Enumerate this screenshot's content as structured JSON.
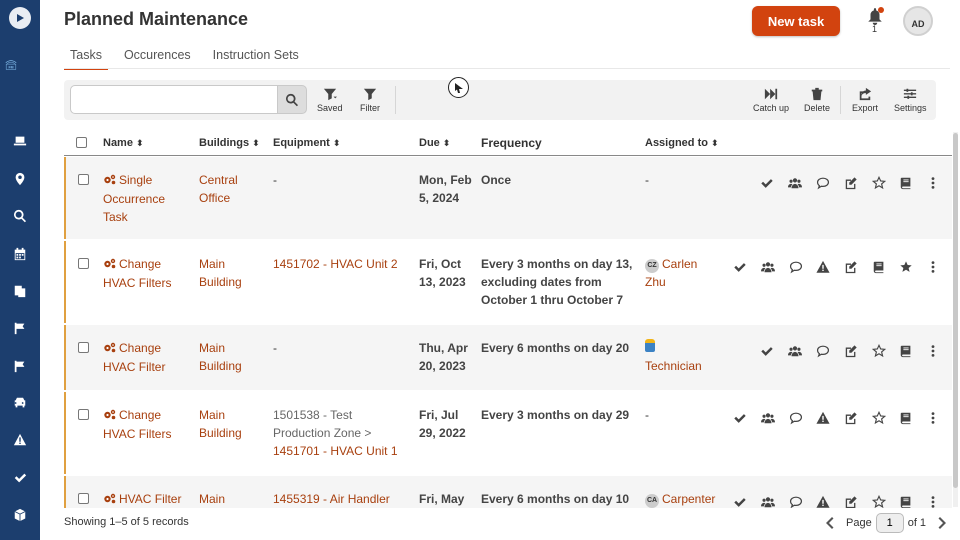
{
  "app": {
    "title": "Planned Maintenance",
    "new_task_label": "New task",
    "notifications_count": "1",
    "user_initials": "AD"
  },
  "tabs": [
    {
      "label": "Tasks",
      "active": true
    },
    {
      "label": "Occurences",
      "active": false
    },
    {
      "label": "Instruction Sets",
      "active": false
    }
  ],
  "toolbar": {
    "search_value": "",
    "search_placeholder": "",
    "saved_label": "Saved",
    "filter_label": "Filter",
    "catch_up_label": "Catch up",
    "delete_label": "Delete",
    "export_label": "Export",
    "settings_label": "Settings"
  },
  "table": {
    "columns": {
      "name": "Name",
      "buildings": "Buildings",
      "equipment": "Equipment",
      "due": "Due",
      "frequency": "Frequency",
      "assigned": "Assigned to"
    },
    "rows": [
      {
        "name": [
          "Single",
          "Occurrence",
          "Task"
        ],
        "building": [
          "Central",
          "Office"
        ],
        "equipment_plain": [
          "-"
        ],
        "equipment_link": [],
        "due": [
          "Mon, Feb",
          "5, 2024"
        ],
        "frequency": [
          "Once"
        ],
        "assigned": [
          "-"
        ],
        "assigned_badge": "",
        "assigned_link": false
      },
      {
        "name": [
          "Change",
          "HVAC Filters"
        ],
        "building": [
          "Main",
          "Building"
        ],
        "equipment_plain": [],
        "equipment_link": [
          "1451702 - HVAC Unit 2"
        ],
        "due": [
          "Fri, Oct",
          "13, 2023"
        ],
        "frequency": [
          "Every 3 months on day 13,",
          "excluding dates from",
          "October 1 thru October 7"
        ],
        "assigned": [
          "Carlen",
          "Zhu"
        ],
        "assigned_badge": "CZ",
        "assigned_link": true
      },
      {
        "name": [
          "Change",
          "HVAC Filter"
        ],
        "building": [
          "Main",
          "Building"
        ],
        "equipment_plain": [
          "-"
        ],
        "equipment_link": [],
        "due": [
          "Thu, Apr",
          "20, 2023"
        ],
        "frequency": [
          "Every 6 months on day 20"
        ],
        "assigned": [
          "Technician"
        ],
        "assigned_badge": "",
        "assigned_link": true
      },
      {
        "name": [
          "Change",
          "HVAC Filters"
        ],
        "building": [
          "Main",
          "Building"
        ],
        "equipment_plain": [
          "1501538 - Test",
          "Production Zone >"
        ],
        "equipment_link": [
          "1451701 - HVAC Unit 1"
        ],
        "due": [
          "Fri, Jul",
          "29, 2022"
        ],
        "frequency": [
          "Every 3 months on day 29"
        ],
        "assigned": [
          "-"
        ],
        "assigned_badge": "",
        "assigned_link": false
      },
      {
        "name": [
          "HVAC Filter"
        ],
        "building": [
          "Main"
        ],
        "equipment_plain": [],
        "equipment_link": [
          "1455319 - Air Handler"
        ],
        "due": [
          "Fri, May"
        ],
        "frequency": [
          "Every 6 months on day 10"
        ],
        "assigned": [
          "Carpenter"
        ],
        "assigned_badge": "CA",
        "assigned_link": true
      }
    ]
  },
  "footer": {
    "records_text": "Showing 1–5 of 5 records",
    "page_label": "Page",
    "page_value": "1",
    "of_label": "of 1"
  }
}
